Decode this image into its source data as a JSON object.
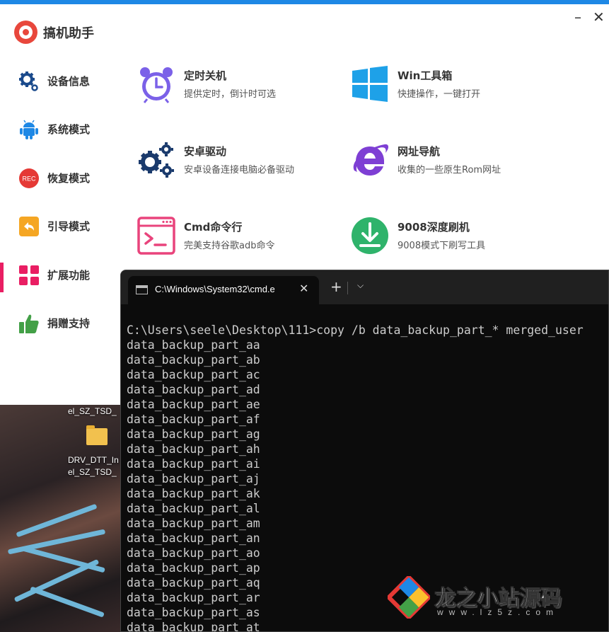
{
  "app": {
    "title": "搞机助手",
    "min_glyph": "–",
    "close_glyph": "✕",
    "sidebar": [
      {
        "label": "设备信息",
        "icon": "gear-icon"
      },
      {
        "label": "系统模式",
        "icon": "android-icon"
      },
      {
        "label": "恢复模式",
        "icon": "rec-icon",
        "badge": "REC"
      },
      {
        "label": "引导模式",
        "icon": "back-arrow-icon"
      },
      {
        "label": "扩展功能",
        "icon": "grid-icon",
        "active": true
      },
      {
        "label": "捐赠支持",
        "icon": "thumbs-up-icon"
      }
    ],
    "tools": [
      {
        "title": "定时关机",
        "desc": "提供定时，倒计时可选",
        "icon": "alarm-clock-icon"
      },
      {
        "title": "Win工具箱",
        "desc": "快捷操作，一键打开",
        "icon": "windows-logo-icon"
      },
      {
        "title": "安卓驱动",
        "desc": "安卓设备连接电脑必备驱动",
        "icon": "gears-icon"
      },
      {
        "title": "网址导航",
        "desc": "收集的一些原生Rom网址",
        "icon": "ie-logo-icon"
      },
      {
        "title": "Cmd命令行",
        "desc": "完美支持谷歌adb命令",
        "icon": "terminal-icon"
      },
      {
        "title": "9008深度刷机",
        "desc": "9008模式下刷写工具",
        "icon": "download-icon"
      }
    ]
  },
  "desktop": {
    "label_top": "el_SZ_TSD_",
    "file_line1": "DRV_DTT_In",
    "file_line2": "el_SZ_TSD_"
  },
  "terminal": {
    "tab_title": "C:\\Windows\\System32\\cmd.e",
    "tab_close": "✕",
    "new_tab": "+",
    "dropdown": "⌵",
    "command": "C:\\Users\\seele\\Desktop\\111>copy /b data_backup_part_* merged_user",
    "output": [
      "data_backup_part_aa",
      "data_backup_part_ab",
      "data_backup_part_ac",
      "data_backup_part_ad",
      "data_backup_part_ae",
      "data_backup_part_af",
      "data_backup_part_ag",
      "data_backup_part_ah",
      "data_backup_part_ai",
      "data_backup_part_aj",
      "data_backup_part_ak",
      "data_backup_part_al",
      "data_backup_part_am",
      "data_backup_part_an",
      "data_backup_part_ao",
      "data_backup_part_ap",
      "data_backup_part_aq",
      "data_backup_part_ar",
      "data_backup_part_as",
      "data_backup_part_at"
    ]
  },
  "watermark": {
    "text": "龙之小站源码",
    "sub": "www.lz5z.com"
  },
  "colors": {
    "accent_active": "#e91e63",
    "top_line": "#1e88e5",
    "terminal_bg": "#0c0c0c"
  }
}
